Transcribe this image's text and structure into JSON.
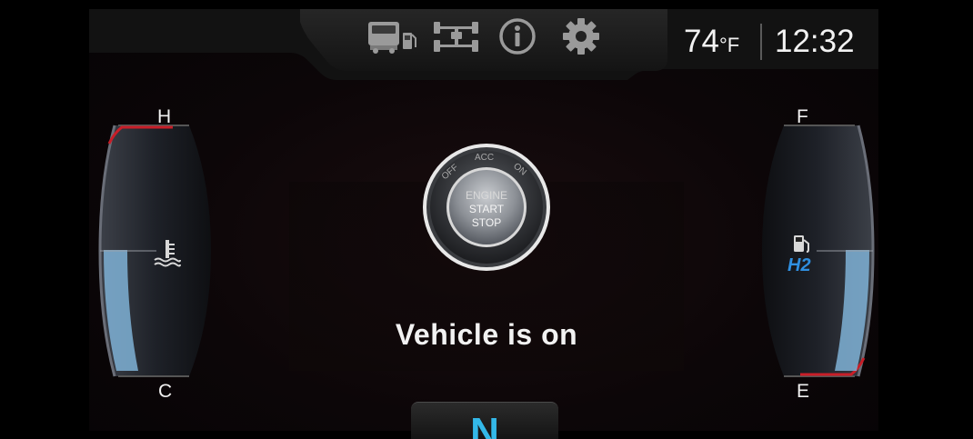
{
  "topbar": {
    "icons": [
      "truck-fuel-icon",
      "drivetrain-icon",
      "info-icon",
      "settings-gear-icon"
    ]
  },
  "status": {
    "temperature": "74",
    "temperature_unit": "°F",
    "time": "12:32"
  },
  "coolant_gauge": {
    "high_label": "H",
    "low_label": "C",
    "icon": "coolant-temperature-icon",
    "level": 0.5
  },
  "fuel_gauge": {
    "full_label": "F",
    "empty_label": "E",
    "icon": "fuel-pump-icon",
    "fuel_type": "H2",
    "level": 0.5
  },
  "engine_button": {
    "positions": [
      "OFF",
      "ACC",
      "ON"
    ],
    "line1": "ENGINE",
    "line2": "START",
    "line3": "STOP"
  },
  "message": "Vehicle is on",
  "gear": "N",
  "colors": {
    "accent_blue": "#33b8e8",
    "warning_red": "#c81e28"
  }
}
